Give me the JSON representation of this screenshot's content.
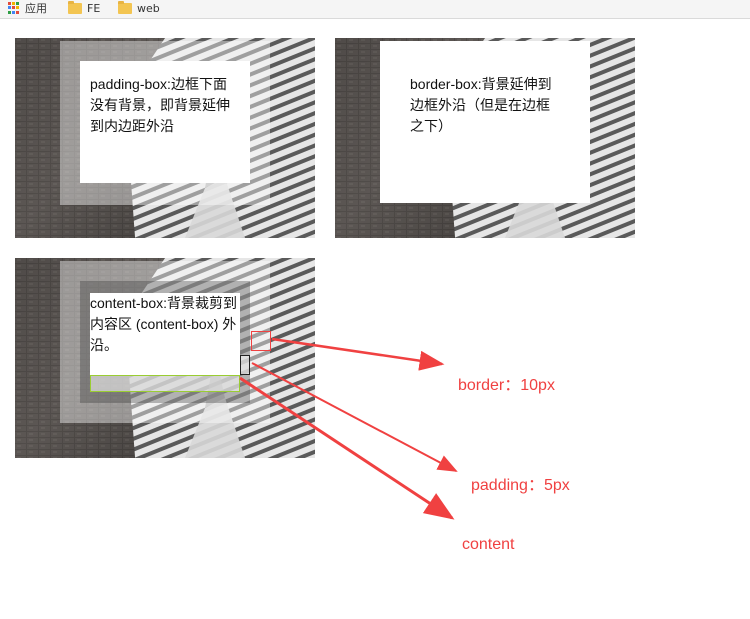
{
  "bookmarks": {
    "items": [
      {
        "label": "应用",
        "icon": "apps-grid-icon"
      },
      {
        "label": "FE",
        "icon": "folder-icon"
      },
      {
        "label": "web",
        "icon": "folder-icon"
      }
    ]
  },
  "demos": {
    "padding_box": {
      "text": "padding-box:边框下面没有背景，即背景延伸到内边距外沿"
    },
    "border_box": {
      "text": "border-box:背景延伸到边框外沿（但是在边框之下）"
    },
    "content_box": {
      "text": "content-box:背景裁剪到内容区 (content-box) 外沿。"
    }
  },
  "annotations": {
    "border": "border：10px",
    "padding": "padding：5px",
    "content": "content"
  },
  "colors": {
    "annotation_red": "#f04141",
    "highlight_yellow_green": "#9acd32",
    "frame_translucent_white": "rgba(255,255,255,0.45)"
  }
}
